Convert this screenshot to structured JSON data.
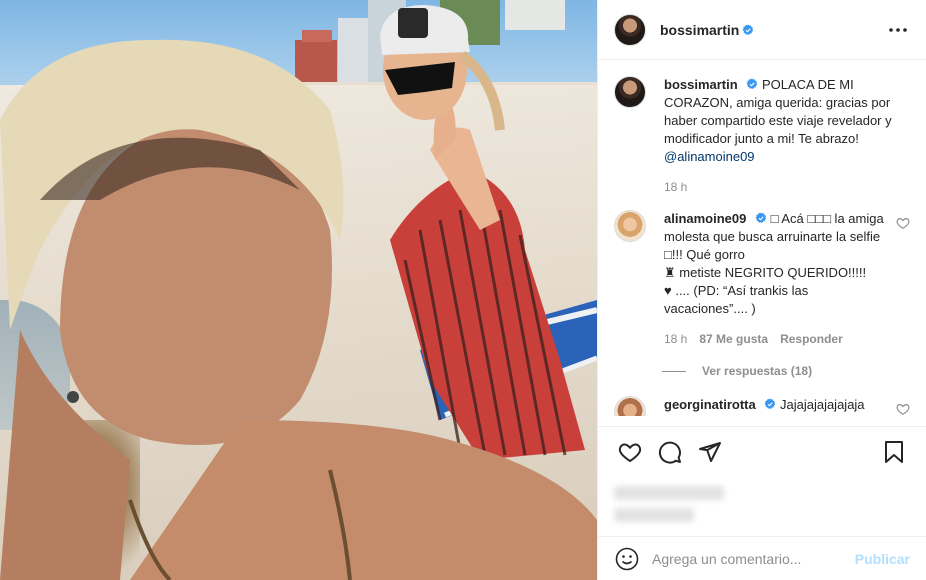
{
  "colors": {
    "verified": "#3897f0",
    "text": "#262626",
    "muted": "#8e8e8e",
    "link": "#00376b",
    "publish_disabled": "#b2dffc"
  },
  "post": {
    "photo_alt": "Selfie en la playa"
  },
  "header": {
    "username": "bossimartin",
    "verified_icon": "verified-badge-icon",
    "more_icon": "more-options-icon"
  },
  "caption": {
    "username": "bossimartin",
    "text": "POLACA DE MI CORAZON, amiga querida: gracias por haber compartido este viaje revelador y modificador junto a mi! Te abrazo!",
    "mention": "@alinamoine09",
    "time": "18 h"
  },
  "comments": [
    {
      "username": "alinamoine09",
      "text_line1": "□ Acá □□□ la amiga molesta que busca arruinarte la selfie □!!! Qué gorro",
      "text_line2": "♜ metiste NEGRITO QUERIDO!!!!!",
      "text_line3": "♥ .... (PD: “Así trankis las vacaciones”.... )",
      "time": "18 h",
      "likes": "87 Me gusta",
      "reply": "Responder",
      "view_replies": "Ver respuestas (18)"
    },
    {
      "username": "georginatirotta",
      "text": "Jajajajajajajaja"
    }
  ],
  "add_comment": {
    "placeholder": "Agrega un comentario...",
    "publish": "Publicar"
  }
}
